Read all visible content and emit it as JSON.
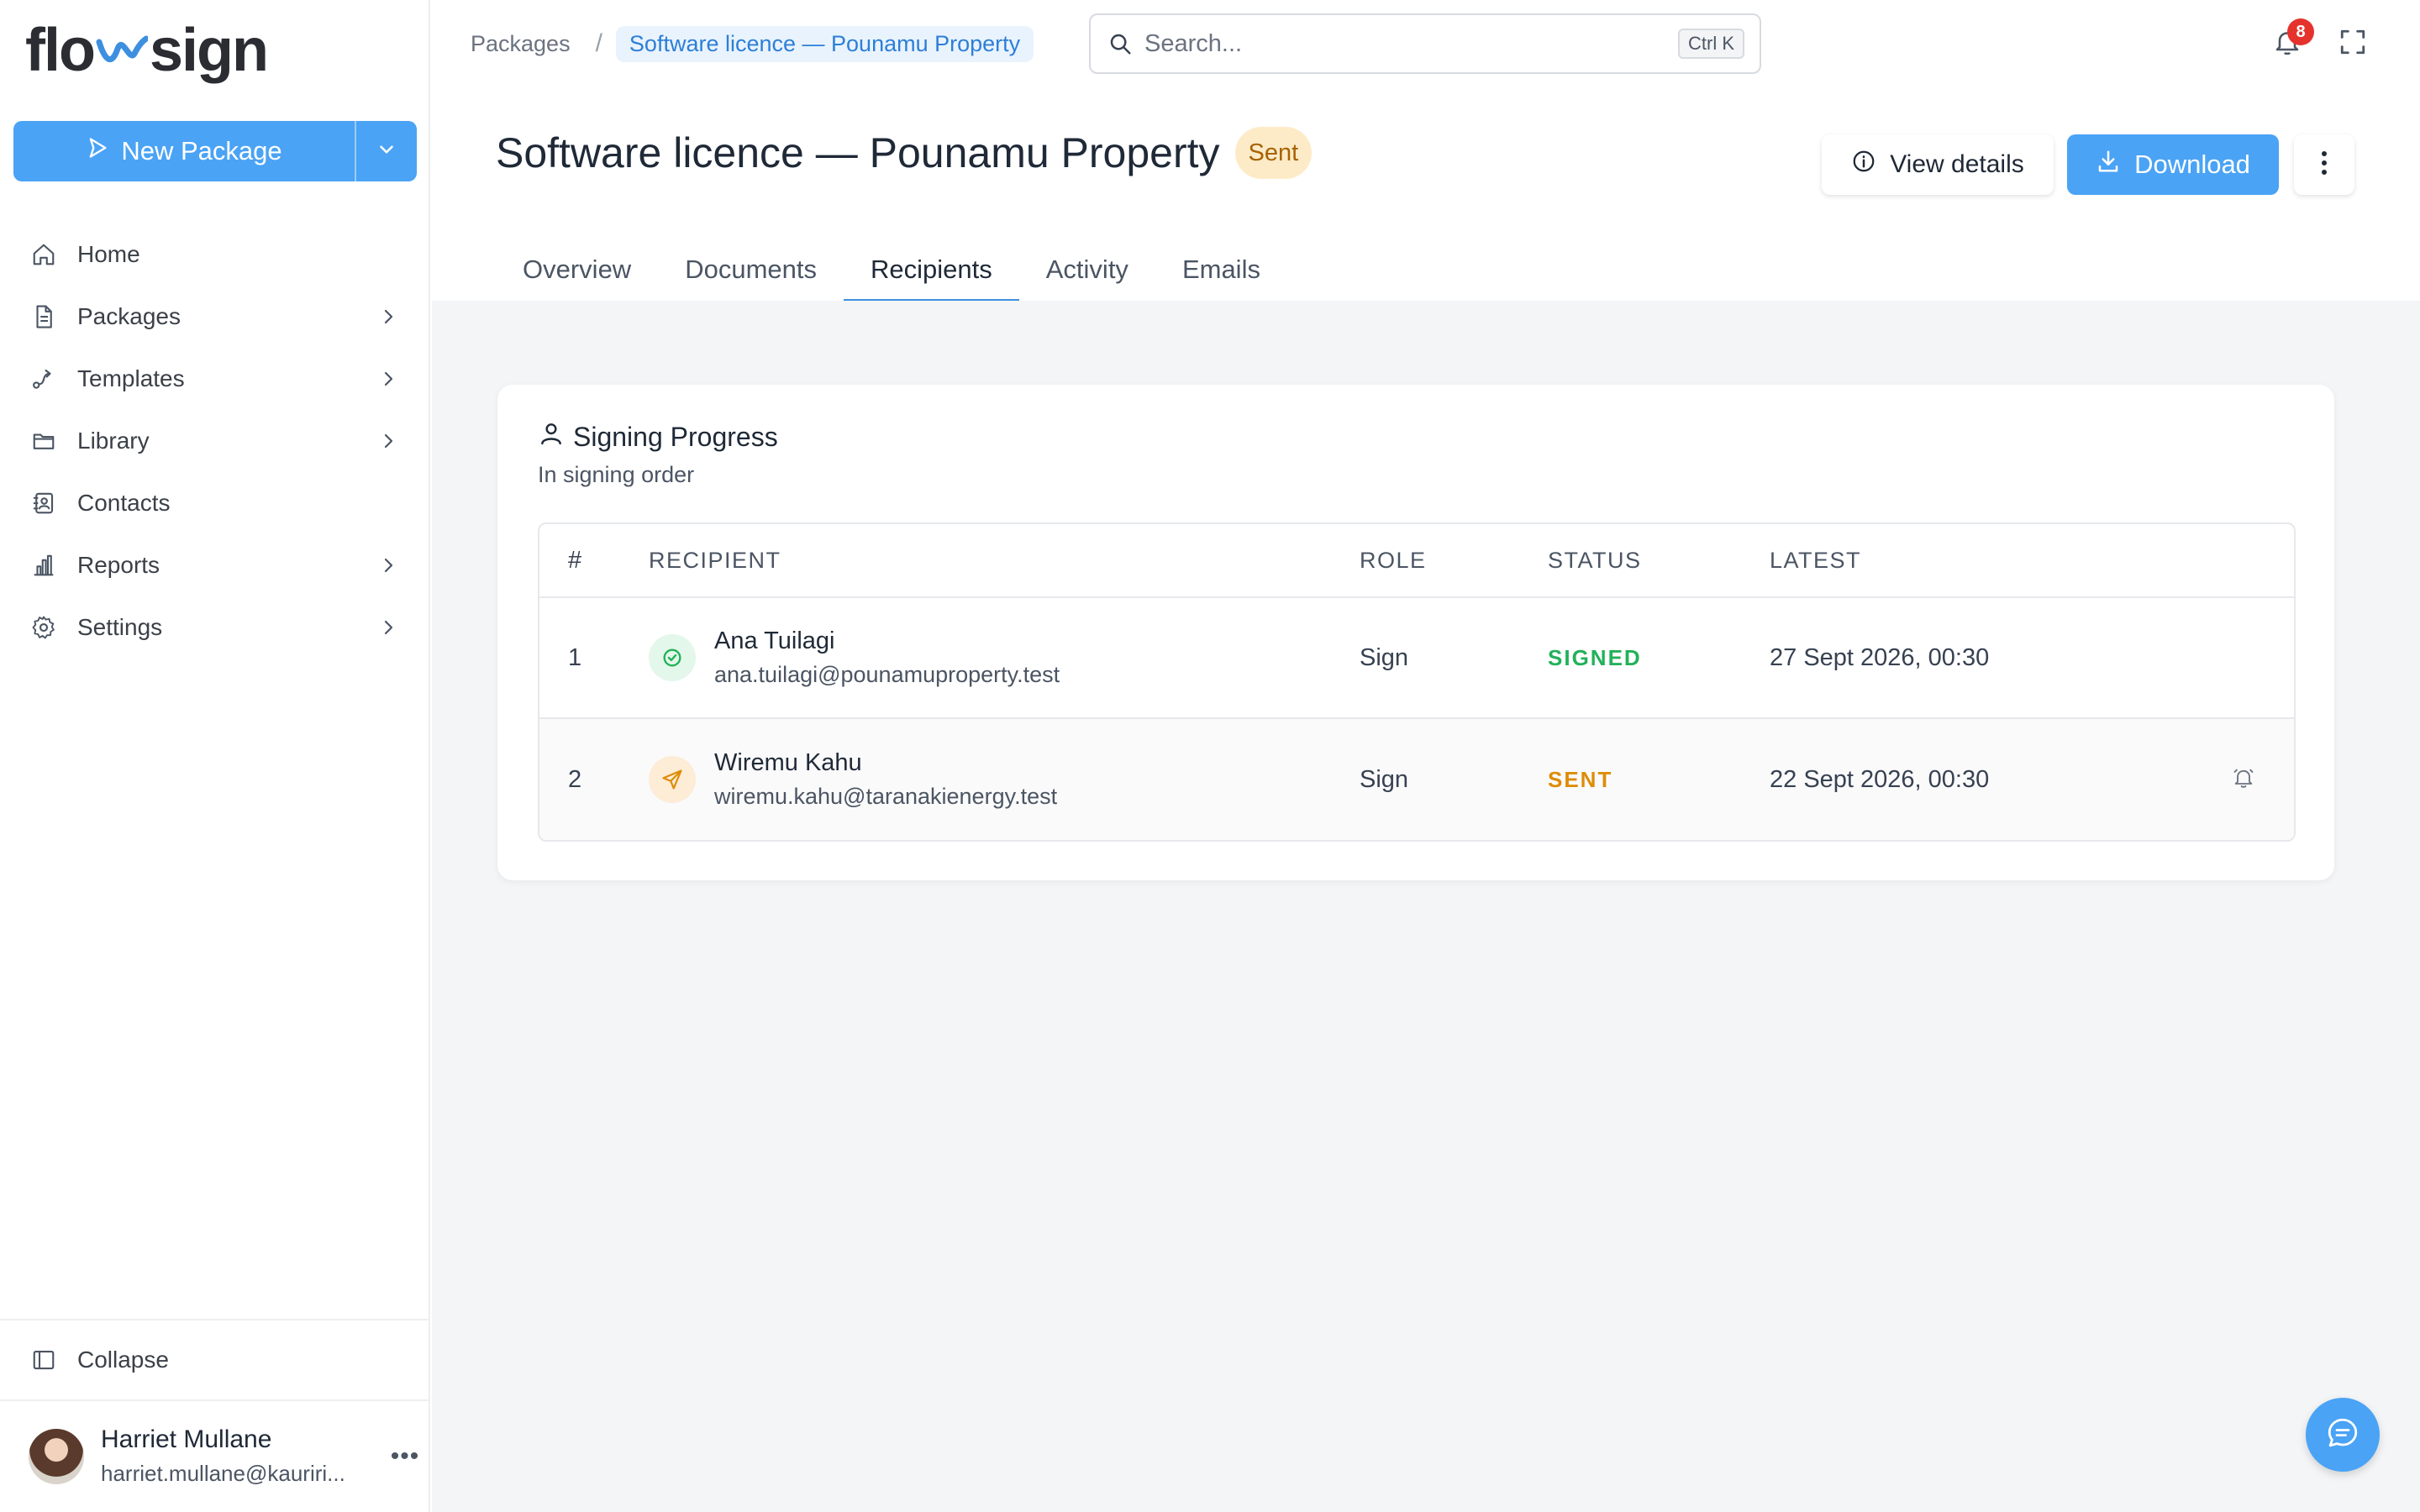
{
  "app": {
    "logo_left": "flo",
    "logo_right": "sign"
  },
  "sidebar": {
    "new_package_label": "New Package",
    "items": [
      {
        "label": "Home",
        "icon": "home-icon",
        "has_chevron": false
      },
      {
        "label": "Packages",
        "icon": "document-icon",
        "has_chevron": true
      },
      {
        "label": "Templates",
        "icon": "route-icon",
        "has_chevron": true
      },
      {
        "label": "Library",
        "icon": "folder-icon",
        "has_chevron": true
      },
      {
        "label": "Contacts",
        "icon": "contact-book-icon",
        "has_chevron": false
      },
      {
        "label": "Reports",
        "icon": "bar-chart-icon",
        "has_chevron": true
      },
      {
        "label": "Settings",
        "icon": "gear-icon",
        "has_chevron": true
      }
    ],
    "collapse_label": "Collapse",
    "user": {
      "name": "Harriet Mullane",
      "email": "harriet.mullane@kauriri..."
    }
  },
  "topbar": {
    "breadcrumb_root": "Packages",
    "breadcrumb_sep": "/",
    "breadcrumb_current": "Software licence — Pounamu Property",
    "search_placeholder": "Search...",
    "search_shortcut": "Ctrl K",
    "notification_count": "8"
  },
  "header": {
    "title": "Software licence — Pounamu Property",
    "status": "Sent",
    "view_details_label": "View details",
    "download_label": "Download"
  },
  "tabs": [
    {
      "label": "Overview",
      "active": false
    },
    {
      "label": "Documents",
      "active": false
    },
    {
      "label": "Recipients",
      "active": true
    },
    {
      "label": "Activity",
      "active": false
    },
    {
      "label": "Emails",
      "active": false
    }
  ],
  "signing": {
    "title": "Signing Progress",
    "subtitle": "In signing order",
    "columns": {
      "num": "#",
      "recipient": "RECIPIENT",
      "role": "ROLE",
      "status": "STATUS",
      "latest": "LATEST"
    },
    "rows": [
      {
        "num": "1",
        "name": "Ana Tuilagi",
        "email": "ana.tuilagi@pounamuproperty.test",
        "role": "Sign",
        "status": "SIGNED",
        "latest": "27 Sept 2026, 00:30"
      },
      {
        "num": "2",
        "name": "Wiremu Kahu",
        "email": "wiremu.kahu@taranakienergy.test",
        "role": "Sign",
        "status": "SENT",
        "latest": "22 Sept 2026, 00:30"
      }
    ]
  },
  "colors": {
    "accent": "#4aa3f5",
    "signed": "#22b15a",
    "sent": "#de8d06",
    "badge": "#e5322d"
  }
}
